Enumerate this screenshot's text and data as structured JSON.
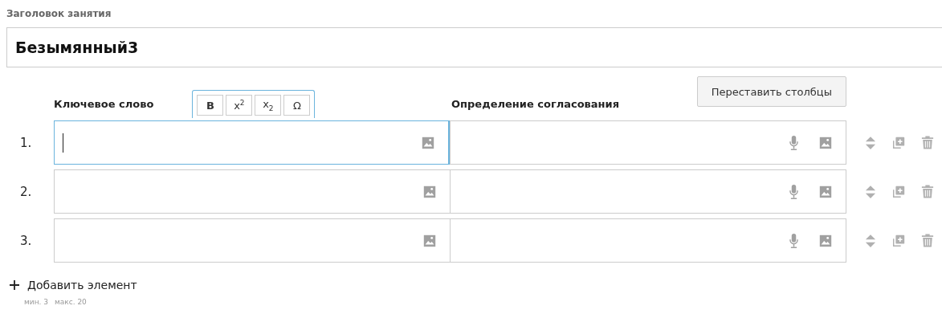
{
  "title_field": {
    "label": "Заголовок занятия",
    "value": "Безымянный3"
  },
  "columns": [
    {
      "heading": "Ключевое слово"
    },
    {
      "heading": "Определение согласования"
    }
  ],
  "format_toolbar": [
    {
      "label": "B",
      "kind": "bold"
    },
    {
      "label": "x$^{2}$",
      "kind": "plain"
    },
    {
      "label": "x$_{2}$",
      "kind": "plain"
    },
    {
      "label": "Ω",
      "kind": "plain"
    }
  ],
  "swap_button": "Переставить столбцы",
  "rows": [
    {
      "number": "1.",
      "focused": true
    },
    {
      "number": "2.",
      "focused": false
    },
    {
      "number": "3.",
      "focused": false
    }
  ],
  "add_button": "Добавить элемент",
  "limits": [
    "мин. 3",
    "макс. 20"
  ]
}
